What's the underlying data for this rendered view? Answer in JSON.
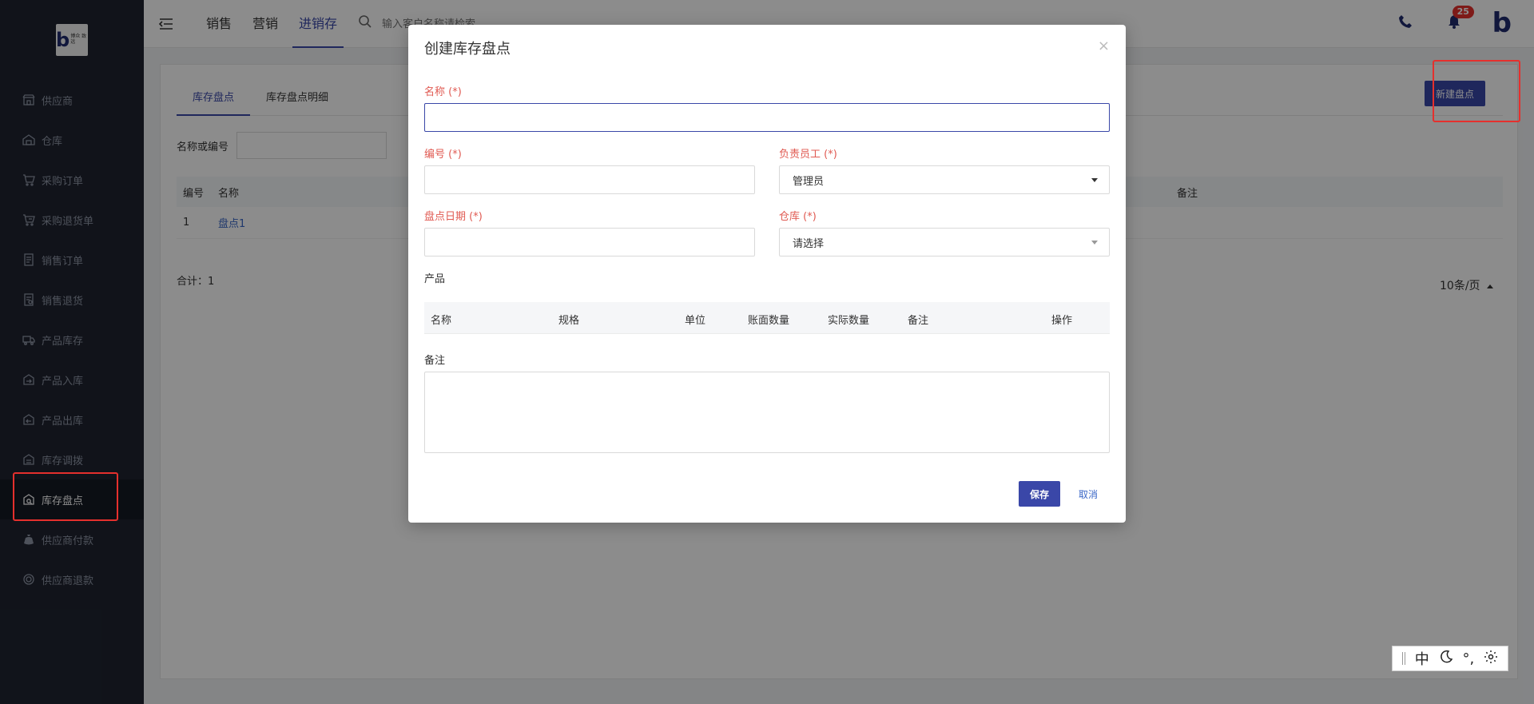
{
  "sidebar": {
    "logo": {
      "letter": "b",
      "text": "博众 致远"
    },
    "items": [
      {
        "label": "供应商",
        "icon": "store-icon"
      },
      {
        "label": "仓库",
        "icon": "warehouse-icon"
      },
      {
        "label": "采购订单",
        "icon": "cart-icon"
      },
      {
        "label": "采购退货单",
        "icon": "cart-return-icon"
      },
      {
        "label": "销售订单",
        "icon": "document-icon"
      },
      {
        "label": "销售退货",
        "icon": "document-return-icon"
      },
      {
        "label": "产品库存",
        "icon": "truck-icon"
      },
      {
        "label": "产品入库",
        "icon": "box-in-icon"
      },
      {
        "label": "产品出库",
        "icon": "box-out-icon"
      },
      {
        "label": "库存调拨",
        "icon": "transfer-icon"
      },
      {
        "label": "库存盘点",
        "icon": "inventory-check-icon",
        "active": true
      },
      {
        "label": "供应商付款",
        "icon": "money-bag-icon"
      },
      {
        "label": "供应商退款",
        "icon": "refund-icon"
      }
    ]
  },
  "topbar": {
    "tabs": [
      "销售",
      "营销",
      "进销存"
    ],
    "active_tab": "进销存",
    "search_placeholder": "输入客户名称请检索",
    "notification_count": "25",
    "brand_letter": "b"
  },
  "page": {
    "tabs": [
      "库存盘点",
      "库存盘点明细"
    ],
    "filter_label": "名称或编号",
    "new_button": "新建盘点",
    "table": {
      "headers": [
        "编号",
        "名称",
        "备注"
      ],
      "rows": [
        {
          "id": "1",
          "name": "盘点1"
        }
      ]
    },
    "total": "合计：1",
    "page_size": "10条/页"
  },
  "modal": {
    "title": "创建库存盘点",
    "close": "×",
    "name_label": "名称 (*)",
    "number_label": "编号 (*)",
    "employee_label": "负责员工 (*)",
    "employee_value": "管理员",
    "date_label": "盘点日期 (*)",
    "warehouse_label": "仓库 (*)",
    "warehouse_placeholder": "请选择",
    "products_label": "产品",
    "product_headers": [
      "名称",
      "规格",
      "单位",
      "账面数量",
      "实际数量",
      "备注",
      "操作"
    ],
    "remark_label": "备注",
    "save": "保存",
    "cancel": "取消"
  },
  "ime": {
    "mode": "中",
    "punct": "°,"
  },
  "colors": {
    "primary": "#3a47a8",
    "required": "#e05a52",
    "sidebar": "#1f2431",
    "highlight": "#e5302d"
  }
}
